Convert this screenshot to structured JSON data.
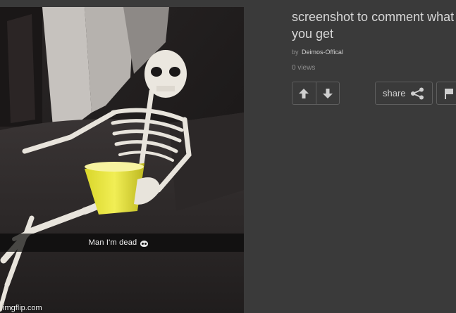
{
  "post": {
    "title": "screenshot to comment what you get",
    "by_label": "by",
    "author": "Deimos-Offical",
    "views": "0 views"
  },
  "image": {
    "caption": "Man I'm dead",
    "watermark": "imgflip.com"
  },
  "actions": {
    "upvote_icon": "arrow-up-icon",
    "downvote_icon": "arrow-down-icon",
    "share_label": "share",
    "share_icon": "share-icon",
    "flag_icon": "flag-icon"
  },
  "colors": {
    "background": "#3a3a3a",
    "text": "#d8d8d8",
    "muted": "#8f8f8f",
    "border": "#5e5e5e"
  }
}
